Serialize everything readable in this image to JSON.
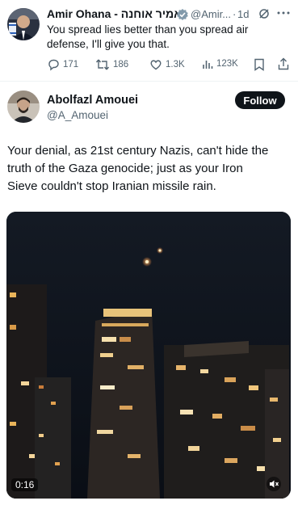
{
  "reply_tweet": {
    "author_name": "Amir Ohana - אמיר אוחנה",
    "handle": "@Amir...",
    "separator": "·",
    "time": "1d",
    "text_line1": "You spread lies better than you spread air",
    "text_line2": "defense, I'll give you that.",
    "metrics": {
      "replies": "171",
      "retweets": "186",
      "likes": "1.3K",
      "views": "123K"
    }
  },
  "main_tweet": {
    "author_name": "Abolfazl Amouei",
    "handle": "@A_Amouei",
    "follow_label": "Follow",
    "text_line1": "Your denial, as 21st century Nazis, can't hide the",
    "text_line2": "truth of the Gaza genocide; just as your Iron",
    "text_line3": "Sieve couldn't stop Iranian missile rain.",
    "video_time": "0:16"
  },
  "colors": {
    "text": "#0f1419",
    "secondary": "#536471",
    "verified_grey": "#829aab",
    "button": "#0f1419"
  }
}
